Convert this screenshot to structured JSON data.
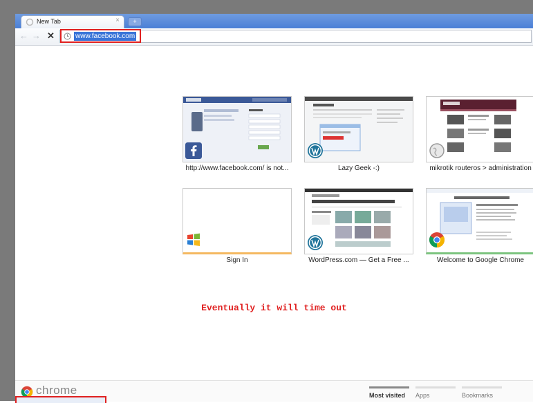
{
  "browser": {
    "tab_title": "New Tab",
    "tab_close": "×",
    "new_tab": "+",
    "back": "←",
    "forward": "→",
    "stop": "✕",
    "url": "www.facebook.com"
  },
  "most_visited": [
    {
      "caption": "http://www.facebook.com/ is not...",
      "icon": "facebook-icon",
      "accent": "#3b5998"
    },
    {
      "caption": "Lazy Geek -:)",
      "icon": "wordpress-icon",
      "accent": "#21759b"
    },
    {
      "caption": "mikrotik routeros > administration",
      "icon": "globe-icon",
      "accent": "#bbbbbb"
    },
    {
      "caption": "Sign In",
      "icon": "windows-live-icon",
      "accent": "#f0a030"
    },
    {
      "caption": "WordPress.com — Get a Free ...",
      "icon": "wordpress-icon",
      "accent": "#21759b"
    },
    {
      "caption": "Welcome to Google Chrome",
      "icon": "chrome-icon",
      "accent": "#4caf50"
    }
  ],
  "note": "Eventually it will time out",
  "footer": {
    "brand": "chrome",
    "tabs": [
      "Most visited",
      "Apps",
      "Bookmarks"
    ]
  },
  "colors": {
    "annotation": "#e02020",
    "url_selection": "#3874d8"
  }
}
